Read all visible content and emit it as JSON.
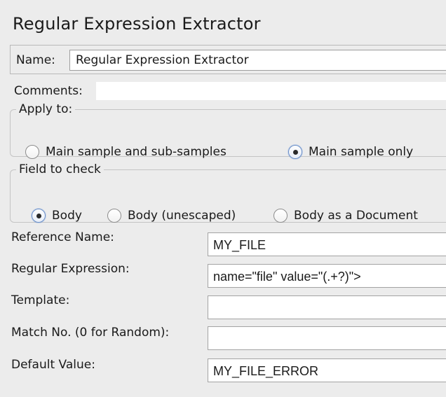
{
  "title": "Regular Expression Extractor",
  "name": {
    "label": "Name:",
    "value": "Regular Expression Extractor"
  },
  "comments": {
    "label": "Comments:",
    "value": ""
  },
  "apply_to": {
    "legend": "Apply to:",
    "options": [
      {
        "label": "Main sample and sub-samples",
        "checked": false
      },
      {
        "label": "Main sample only",
        "checked": true
      }
    ]
  },
  "field_to_check": {
    "legend": "Field to check",
    "options": [
      {
        "label": "Body",
        "checked": true
      },
      {
        "label": "Body (unescaped)",
        "checked": false
      },
      {
        "label": "Body as a Document",
        "checked": false
      }
    ]
  },
  "fields": {
    "reference_name": {
      "label": "Reference Name:",
      "value": "MY_FILE"
    },
    "regular_expression": {
      "label": "Regular Expression:",
      "value": "name=\"file\" value=\"(.+?)\">"
    },
    "template": {
      "label": "Template:",
      "value": ""
    },
    "match_no": {
      "label": "Match No. (0 for Random):",
      "value": ""
    },
    "default_value": {
      "label": "Default Value:",
      "value": "MY_FILE_ERROR"
    }
  }
}
